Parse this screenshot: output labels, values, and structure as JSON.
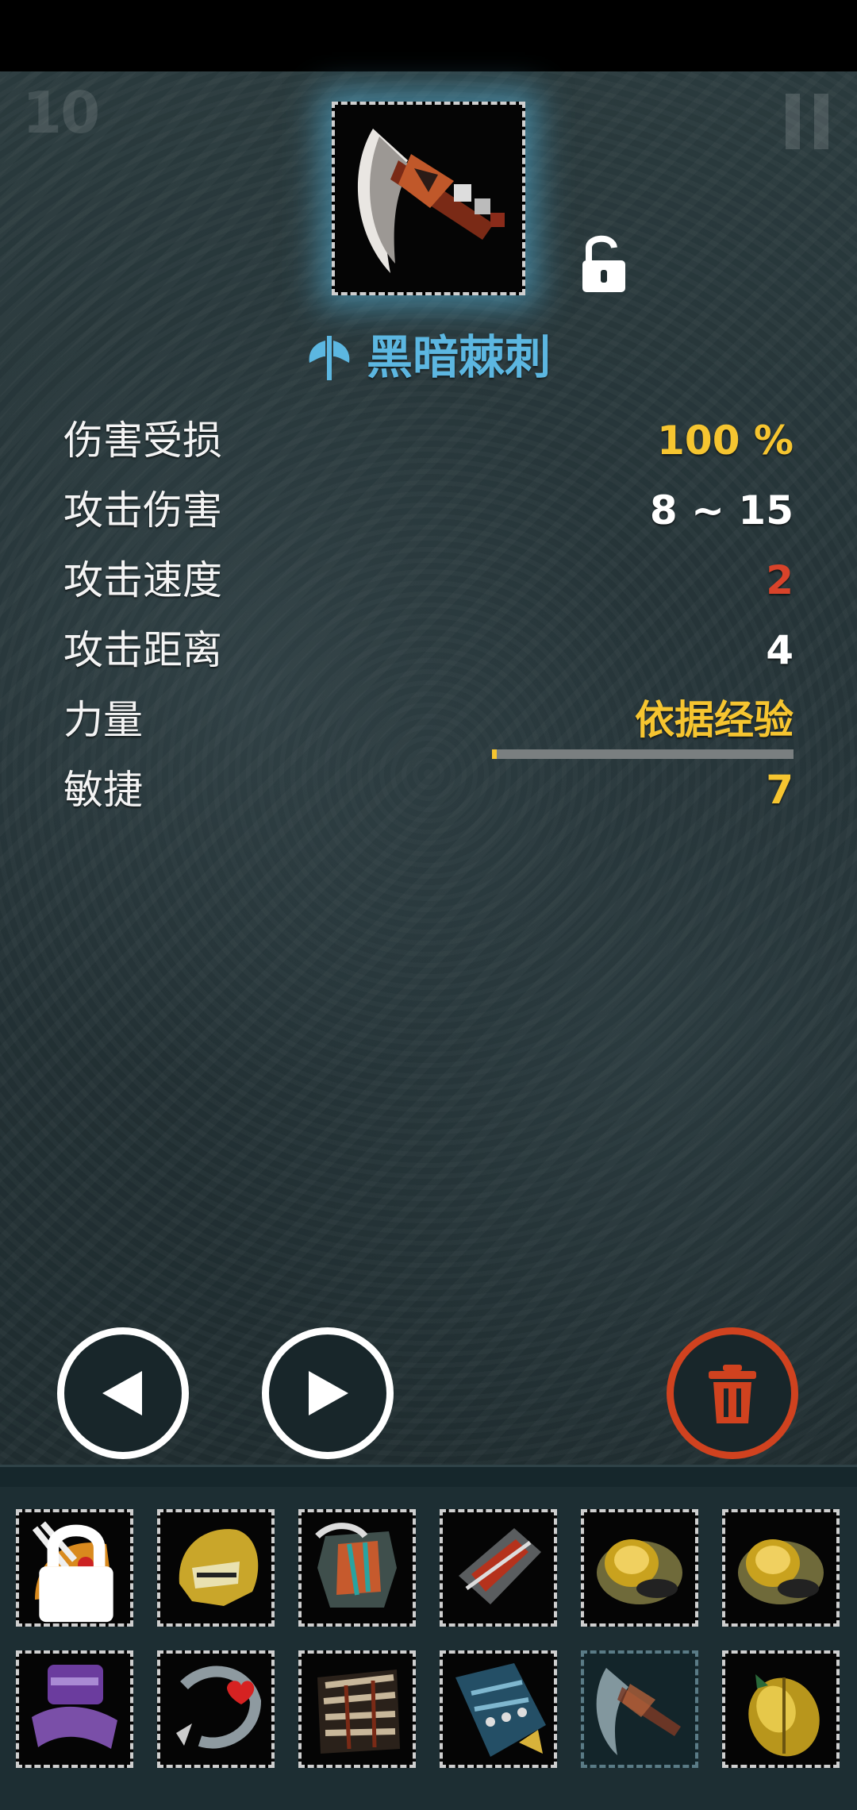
{
  "hud": {
    "level": "10",
    "pause_icon": "pause-icon"
  },
  "item": {
    "name": "黑暗棘刺",
    "type_icon": "axe-icon",
    "lock_state_icon": "unlock-icon",
    "glow_color": "#5cb7e1"
  },
  "stats": [
    {
      "label": "伤害受损",
      "value": "100 %",
      "color": "#f6c530"
    },
    {
      "label": "攻击伤害",
      "value": "8 ~ 15",
      "color": "#ffffff"
    },
    {
      "label": "攻击速度",
      "value": "2",
      "color": "#d8432a"
    },
    {
      "label": "攻击距离",
      "value": "4",
      "color": "#ffffff"
    },
    {
      "label": "力量",
      "value": "依据经验",
      "color": "#f6c530"
    },
    {
      "label": "敏捷",
      "value": "7",
      "color": "#f6c530"
    }
  ],
  "strength_exp_progress": 0.01,
  "controls": {
    "prev_icon": "triangle-left-icon",
    "next_icon": "triangle-right-icon",
    "delete_icon": "trash-icon",
    "delete_color": "#d0421f"
  },
  "inventory": {
    "rows": [
      [
        {
          "item": "jester-hood",
          "locked": true
        },
        {
          "item": "gold-helmet",
          "locked": false
        },
        {
          "item": "chest-armor",
          "locked": false
        },
        {
          "item": "bracer",
          "locked": false
        },
        {
          "item": "gold-ring",
          "locked": false
        },
        {
          "item": "gold-ring",
          "locked": false
        }
      ],
      [
        {
          "item": "purple-belt",
          "locked": false
        },
        {
          "item": "heart-amulet",
          "locked": false
        },
        {
          "item": "striped-armor",
          "locked": false
        },
        {
          "item": "blue-gauntlet",
          "locked": false
        },
        {
          "item": "dark-thorn-axe",
          "locked": false,
          "selected": true
        },
        {
          "item": "golden-scarab",
          "locked": false
        }
      ]
    ]
  }
}
